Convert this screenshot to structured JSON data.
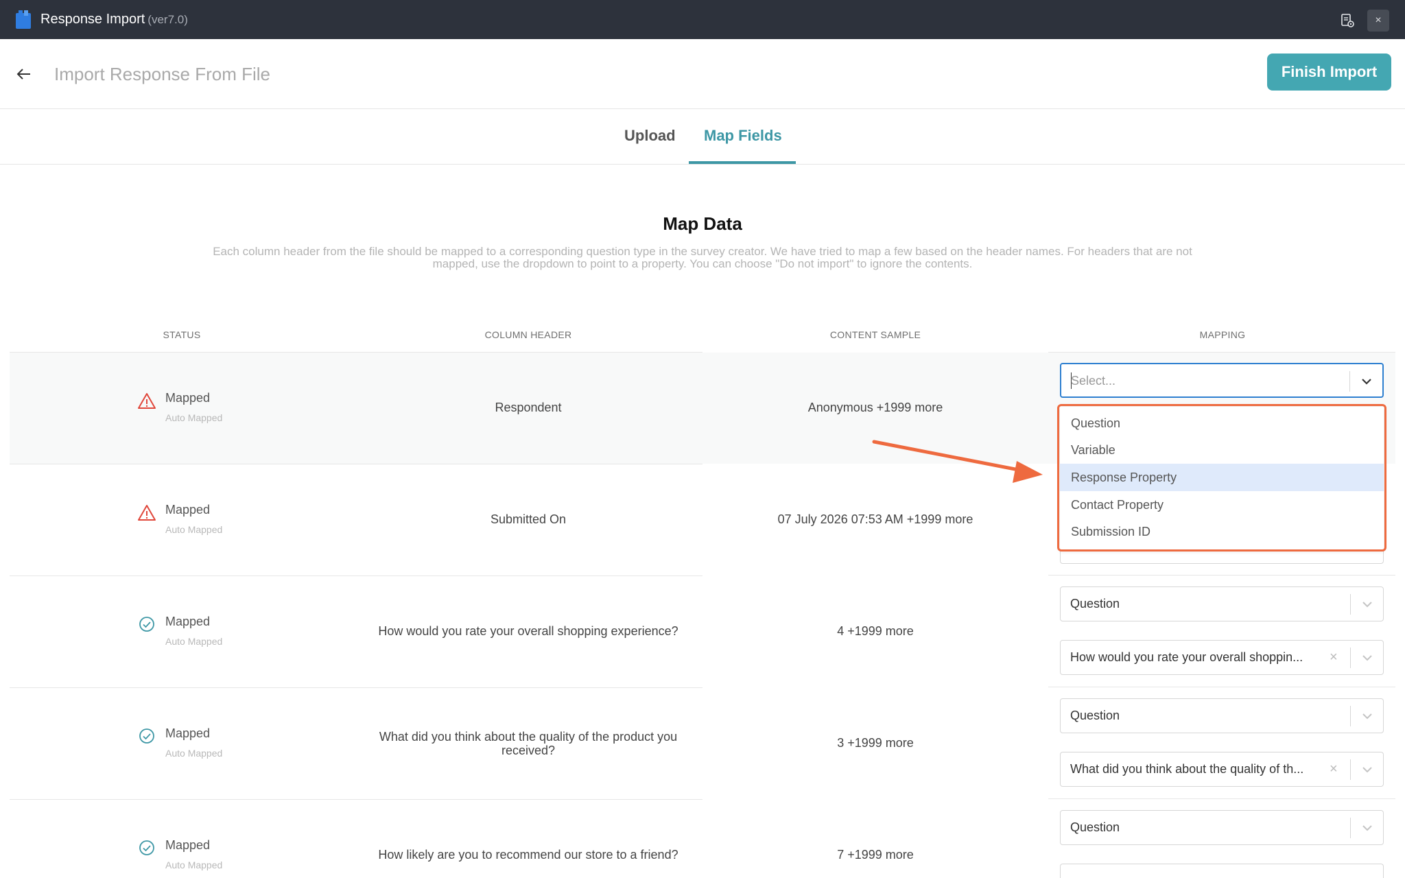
{
  "titlebar": {
    "app_name": "Response Import",
    "version": "(ver7.0)",
    "close_glyph": "×"
  },
  "header": {
    "title": "Import Response From File",
    "finish_label": "Finish Import"
  },
  "tabs": [
    {
      "label": "Upload",
      "active": false
    },
    {
      "label": "Map Fields",
      "active": true
    }
  ],
  "map": {
    "title": "Map Data",
    "description": "Each column header from the file should be mapped to a corresponding question type in the survey creator. We have tried to map a few based on the header names. For headers that are not mapped, use the dropdown to point to a property. You can choose \"Do not import\" to ignore the contents."
  },
  "columns": {
    "status": "STATUS",
    "column_header": "COLUMN HEADER",
    "content_sample": "CONTENT SAMPLE",
    "mapping": "MAPPING"
  },
  "rows": [
    {
      "status": "Mapped",
      "sub": "Auto Mapped",
      "icon": "warning",
      "header": "Respondent",
      "sample": "Anonymous +1999 more"
    },
    {
      "status": "Mapped",
      "sub": "Auto Mapped",
      "icon": "warning",
      "header": "Submitted On",
      "sample": "07 July 2026 07:53 AM +1999 more"
    },
    {
      "status": "Mapped",
      "sub": "Auto Mapped",
      "icon": "check",
      "header": "How would you rate your overall shopping experience?",
      "sample": "4 +1999 more",
      "map_type": "Question",
      "map_target": "How would you rate your overall shoppin..."
    },
    {
      "status": "Mapped",
      "sub": "Auto Mapped",
      "icon": "check",
      "header": "What did you think about the quality of the product you received?",
      "sample": "3 +1999 more",
      "map_type": "Question",
      "map_target": "What did you think about the quality of th..."
    },
    {
      "status": "Mapped",
      "sub": "Auto Mapped",
      "icon": "check",
      "header": "How likely are you to recommend our store to a friend?",
      "sample": "7 +1999 more",
      "map_type": "Question"
    }
  ],
  "select_placeholder": "Select...",
  "dropdown_options": [
    "Question",
    "Variable",
    "Response Property",
    "Contact Property",
    "Submission ID"
  ],
  "highlighted_option": "Response Property",
  "colors": {
    "titlebar": "#2d323c",
    "accent": "#44a7b2",
    "tab_active": "#3d97a5",
    "warning": "#e0463a",
    "check": "#3d97a5",
    "annotation": "#ee6a3f",
    "focus": "#2d7fd0"
  }
}
